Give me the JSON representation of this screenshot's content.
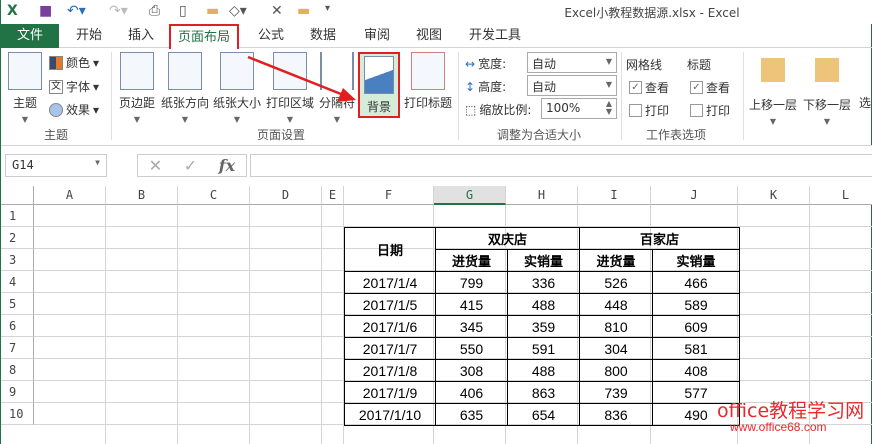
{
  "window": {
    "title": "Excel小教程数据源.xlsx - Excel"
  },
  "tabs": [
    "文件",
    "开始",
    "插入",
    "页面布局",
    "公式",
    "数据",
    "审阅",
    "视图",
    "开发工具"
  ],
  "ribbon": {
    "theme_group": {
      "label": "主题",
      "theme": "主题",
      "colors": "颜色",
      "fonts": "字体",
      "effects": "效果"
    },
    "page_setup_group": {
      "label": "页面设置",
      "margins": "页边距",
      "orientation": "纸张方向",
      "size": "纸张大小",
      "print_area": "打印区域",
      "breaks": "分隔符",
      "background": "背景",
      "print_titles": "打印标题"
    },
    "scale_group": {
      "label": "调整为合适大小",
      "width_label": "宽度:",
      "width_value": "自动",
      "height_label": "高度:",
      "height_value": "自动",
      "scale_label": "缩放比例:",
      "scale_value": "100%"
    },
    "sheet_options_group": {
      "label": "工作表选项",
      "gridlines": "网格线",
      "headings": "标题",
      "view": "查看",
      "print": "打印"
    },
    "arrange": {
      "bring_forward": "上移一层",
      "send_backward": "下移一层",
      "selection": "选"
    }
  },
  "formula_bar": {
    "name_box": "G14",
    "fx": "fx",
    "cancel": "✕",
    "enter": "✓",
    "formula": ""
  },
  "columns": [
    "A",
    "B",
    "C",
    "D",
    "E",
    "F",
    "G",
    "H",
    "I",
    "J",
    "K",
    "L"
  ],
  "rows": [
    "1",
    "2",
    "3",
    "4",
    "5",
    "6",
    "7",
    "8",
    "9",
    "10"
  ],
  "table": {
    "date_header": "日期",
    "store1": "双庆店",
    "store2": "百家店",
    "purchase": "进货量",
    "sales": "实销量",
    "data": [
      [
        "2017/1/4",
        "799",
        "336",
        "526",
        "466"
      ],
      [
        "2017/1/5",
        "415",
        "488",
        "448",
        "589"
      ],
      [
        "2017/1/6",
        "345",
        "359",
        "810",
        "609"
      ],
      [
        "2017/1/7",
        "550",
        "591",
        "304",
        "581"
      ],
      [
        "2017/1/8",
        "308",
        "488",
        "800",
        "408"
      ],
      [
        "2017/1/9",
        "406",
        "863",
        "739",
        "577"
      ],
      [
        "2017/1/10",
        "635",
        "654",
        "836",
        "490"
      ]
    ]
  },
  "watermark": {
    "line1": "office教程学习网",
    "line2": "www.office68.com"
  },
  "colors": {
    "excel_green": "#217346",
    "highlight_red": "#e02020"
  }
}
